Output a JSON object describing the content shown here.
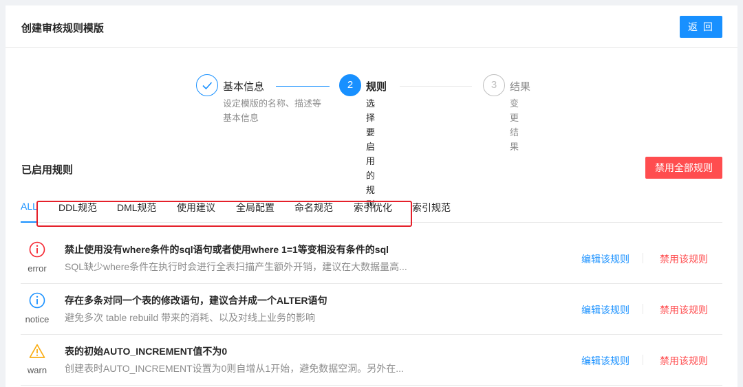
{
  "header": {
    "title": "创建审核规则模版",
    "back_label": "返 回"
  },
  "steps": [
    {
      "number": "",
      "title": "基本信息",
      "desc": "设定模版的名称、描述等基本信息",
      "status": "finished"
    },
    {
      "number": "2",
      "title": "规则",
      "desc": "选择要启用的规则",
      "status": "active"
    },
    {
      "number": "3",
      "title": "结果",
      "desc": "变更结果",
      "status": "waiting"
    }
  ],
  "section": {
    "title": "已启用规则",
    "disable_all_label": "禁用全部规则"
  },
  "tabs": [
    "ALL",
    "DDL规范",
    "DML规范",
    "使用建议",
    "全局配置",
    "命名规范",
    "索引优化",
    "索引规范"
  ],
  "rules": [
    {
      "level": "error",
      "icon": "error-circle-icon",
      "color": "#f5222d",
      "title": "禁止使用没有where条件的sql语句或者使用where 1=1等变相没有条件的sql",
      "desc": "SQL缺少where条件在执行时会进行全表扫描产生额外开销，建议在大数据量高...",
      "edit_label": "编辑该规则",
      "disable_label": "禁用该规则"
    },
    {
      "level": "notice",
      "icon": "info-circle-icon",
      "color": "#1890ff",
      "title": "存在多条对同一个表的修改语句，建议合并成一个ALTER语句",
      "desc": "避免多次 table rebuild 带来的消耗、以及对线上业务的影响",
      "edit_label": "编辑该规则",
      "disable_label": "禁用该规则"
    },
    {
      "level": "warn",
      "icon": "warning-triangle-icon",
      "color": "#faad14",
      "title": "表的初始AUTO_INCREMENT值不为0",
      "desc": "创建表时AUTO_INCREMENT设置为0则自增从1开始，避免数据空洞。另外在...",
      "edit_label": "编辑该规则",
      "disable_label": "禁用该规则"
    }
  ],
  "colors": {
    "primary": "#1890ff",
    "danger": "#ff4d4f",
    "annotation": "#e5202a"
  }
}
